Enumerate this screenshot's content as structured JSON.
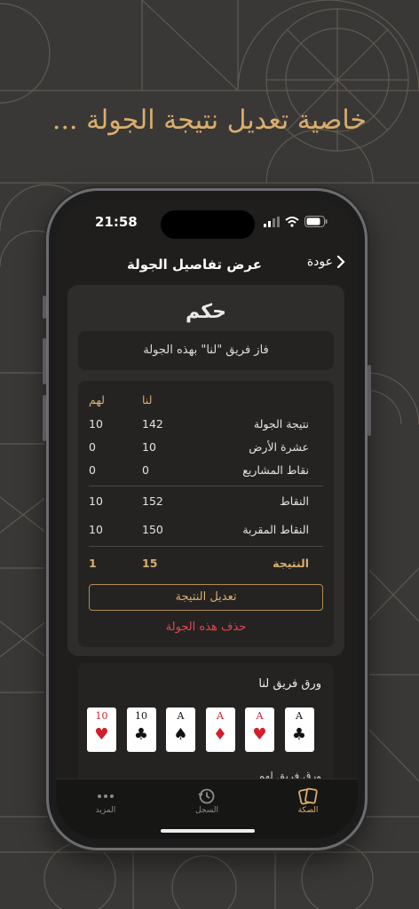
{
  "headline": "خاصية تعديل نتيجة الجولة ...",
  "status_bar": {
    "time": "21:58"
  },
  "nav": {
    "title": "عرض تفاصيل الجولة",
    "back_label": "عودة"
  },
  "round": {
    "title": "حكم",
    "winner_text": "فاز فريق \"لنا\" بهذه الجولة",
    "columns": {
      "us": "لنا",
      "them": "لهم"
    },
    "rows": [
      {
        "label": "نتيجة الجولة",
        "us": "142",
        "them": "10"
      },
      {
        "label": "عشرة الأرض",
        "us": "10",
        "them": "0"
      },
      {
        "label": "نقاط المشاريع",
        "us": "0",
        "them": "0"
      }
    ],
    "points": {
      "label": "النقاط",
      "us": "152",
      "them": "10"
    },
    "rounded": {
      "label": "النقاط المقربة",
      "us": "150",
      "them": "10"
    },
    "result": {
      "label": "النتيجة",
      "us": "15",
      "them": "1"
    },
    "edit_button": "تعديل النتيجة",
    "delete_link": "حذف هذه الجولة"
  },
  "cards": {
    "title": "ورق فريق لنا",
    "hand": [
      {
        "rank": "10",
        "suit": "♥",
        "color": "red"
      },
      {
        "rank": "10",
        "suit": "♣",
        "color": "black"
      },
      {
        "rank": "A",
        "suit": "♠",
        "color": "black"
      },
      {
        "rank": "A",
        "suit": "♦",
        "color": "red"
      },
      {
        "rank": "A",
        "suit": "♥",
        "color": "red"
      },
      {
        "rank": "A",
        "suit": "♣",
        "color": "black"
      }
    ]
  },
  "tabs": [
    {
      "label": "الصكة",
      "icon": "cards-icon",
      "active": true
    },
    {
      "label": "السجل",
      "icon": "history-icon",
      "active": false
    },
    {
      "label": "المزيد",
      "icon": "more-icon",
      "active": false
    }
  ],
  "colors": {
    "accent": "#d9ae6d",
    "danger": "#e0474c",
    "background": "#3a3836"
  }
}
